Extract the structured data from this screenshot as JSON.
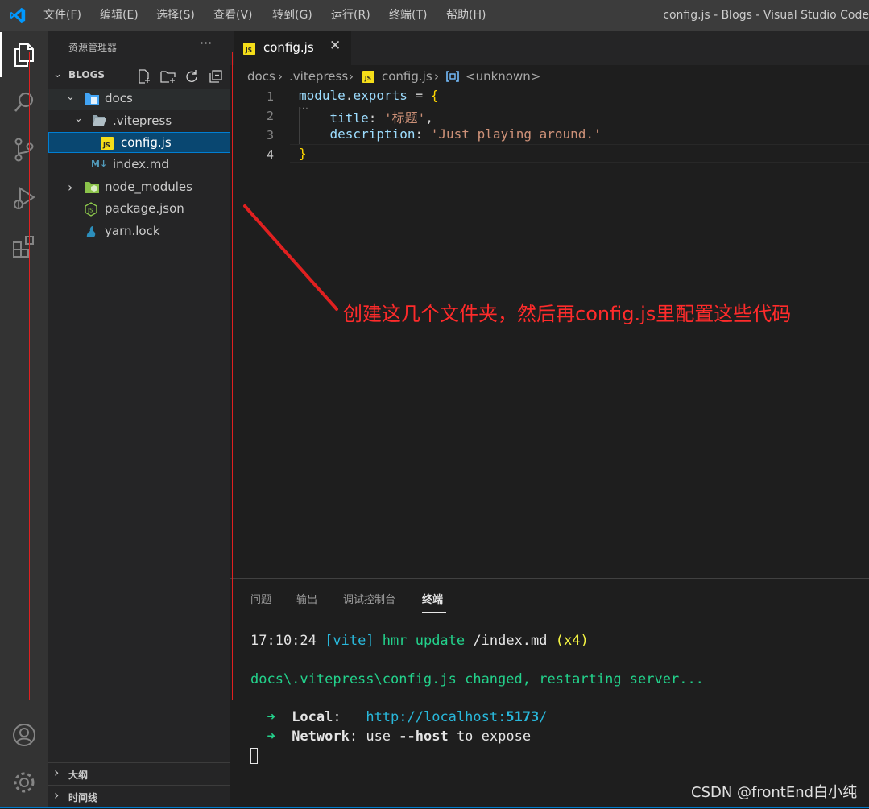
{
  "titlebar": {
    "menus": [
      "文件(F)",
      "编辑(E)",
      "选择(S)",
      "查看(V)",
      "转到(G)",
      "运行(R)",
      "终端(T)",
      "帮助(H)"
    ],
    "window_title": "config.js - Blogs - Visual Studio Code"
  },
  "activity_bar": {
    "items": [
      "files-icon",
      "search-icon",
      "source-control-icon",
      "run-debug-icon",
      "extensions-icon"
    ],
    "bottom": [
      "account-icon",
      "settings-gear-icon"
    ]
  },
  "sidebar": {
    "title": "资源管理器",
    "more": "···",
    "workspace": "BLOGS",
    "tree": [
      {
        "label": "docs",
        "depth": 1,
        "type": "folder",
        "expanded": true
      },
      {
        "label": ".vitepress",
        "depth": 2,
        "type": "folder",
        "expanded": true
      },
      {
        "label": "config.js",
        "depth": 3,
        "type": "js-file",
        "selected": true
      },
      {
        "label": "index.md",
        "depth": 2,
        "type": "md-file"
      },
      {
        "label": "node_modules",
        "depth": 1,
        "type": "folder",
        "expanded": false
      },
      {
        "label": "package.json",
        "depth": 1,
        "type": "json-file"
      },
      {
        "label": "yarn.lock",
        "depth": 1,
        "type": "yarn-file"
      }
    ],
    "sections": {
      "outline": "大纲",
      "timeline": "时间线"
    }
  },
  "editor": {
    "tab": {
      "label": "config.js",
      "close": "✕"
    },
    "breadcrumb": {
      "seg1": "docs",
      "seg2": ".vitepress",
      "seg3": "config.js",
      "seg4": "<unknown>",
      "sep": "›"
    },
    "line_numbers": [
      "1",
      "2",
      "3",
      "4"
    ],
    "code": {
      "l1_obj": "module",
      "l1_dot": ".",
      "l1_prop": "exports",
      "l1_eq": " = ",
      "l1_brace": "{",
      "l2_key": "    title",
      "l2_colon": ": ",
      "l2_val": "'标题'",
      "l2_comma": ",",
      "l3_key": "    description",
      "l3_colon": ": ",
      "l3_val": "'Just playing around.'",
      "l4_brace": "}"
    }
  },
  "panel": {
    "tabs": [
      "问题",
      "输出",
      "调试控制台",
      "终端"
    ],
    "active_tab": "终端",
    "terminal": {
      "l1_time": "17:10:24 ",
      "l1_tag": "[vite]",
      "l1_msg": " hmr update ",
      "l1_path": "/index.md",
      "l1_count": " (x4)",
      "l2": "docs\\.vitepress\\config.js changed, restarting server...",
      "l3_arrow": "  ➜  ",
      "l3_label": "Local",
      "l3_colon": ":   ",
      "l3_url_a": "http://localhost:",
      "l3_port": "5173",
      "l3_url_b": "/",
      "l4_arrow": "  ➜  ",
      "l4_label": "Network",
      "l4_colon": ": ",
      "l4_use": "use ",
      "l4_flag": "--host",
      "l4_rest": " to expose"
    }
  },
  "annotation": "创建这几个文件夹，然后再config.js里配置这些代码",
  "watermark": "CSDN @frontEnd白小纯",
  "colors": {
    "accent": "#007acc",
    "selection": "#094771",
    "annotation": "#ff2b2b"
  }
}
